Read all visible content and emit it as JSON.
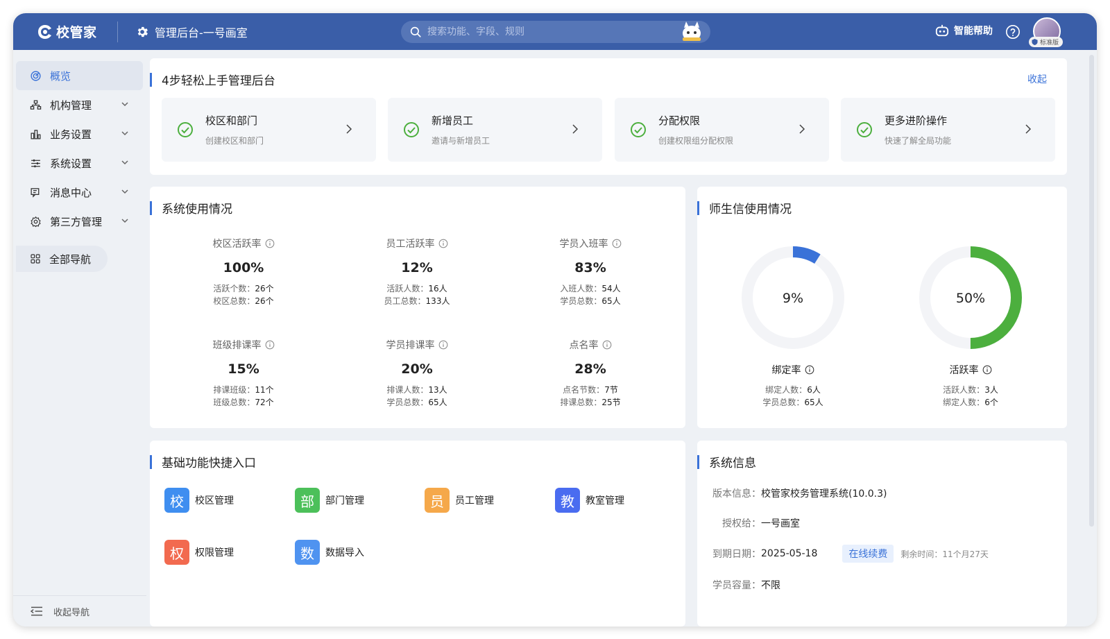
{
  "app": {
    "brand": "校管家",
    "admin_title": "管理后台-一号画室"
  },
  "search": {
    "placeholder": "搜索功能、字段、规则"
  },
  "header": {
    "help_label": "智能帮助",
    "badge_label": "标准版"
  },
  "sidebar": {
    "items": [
      {
        "label": "概览",
        "icon": "dashboard-icon",
        "active": true
      },
      {
        "label": "机构管理",
        "icon": "org-icon"
      },
      {
        "label": "业务设置",
        "icon": "bar-chart-icon"
      },
      {
        "label": "系统设置",
        "icon": "sliders-icon"
      },
      {
        "label": "消息中心",
        "icon": "message-icon"
      },
      {
        "label": "第三方管理",
        "icon": "gear-icon"
      }
    ],
    "all_nav": "全部导航",
    "collapse": "收起导航"
  },
  "guide": {
    "title": "4步轻松上手管理后台",
    "collapse": "收起",
    "steps": [
      {
        "title": "校区和部门",
        "desc": "创建校区和部门"
      },
      {
        "title": "新增员工",
        "desc": "邀请与新增员工"
      },
      {
        "title": "分配权限",
        "desc": "创建权限组分配权限"
      },
      {
        "title": "更多进阶操作",
        "desc": "快速了解全局功能"
      }
    ]
  },
  "usage": {
    "title": "系统使用情况",
    "metrics": [
      {
        "label": "校区活跃率",
        "value": "100%",
        "l1": "活跃个数：",
        "v1": "26个",
        "l2": "校区总数：",
        "v2": "26个"
      },
      {
        "label": "员工活跃率",
        "value": "12%",
        "l1": "活跃人数：",
        "v1": "16人",
        "l2": "员工总数：",
        "v2": "133人"
      },
      {
        "label": "学员入班率",
        "value": "83%",
        "l1": "入班人数：",
        "v1": "54人",
        "l2": "学员总数：",
        "v2": "65人"
      },
      {
        "label": "班级排课率",
        "value": "15%",
        "l1": "排课班级：",
        "v1": "11个",
        "l2": "班级总数：",
        "v2": "72个"
      },
      {
        "label": "学员排课率",
        "value": "20%",
        "l1": "排课人数：",
        "v1": "13人",
        "l2": "学员总数：",
        "v2": "65人"
      },
      {
        "label": "点名率",
        "value": "28%",
        "l1": "点名节数：",
        "v1": "7节",
        "l2": "排课总数：",
        "v2": "25节"
      }
    ]
  },
  "teacher_student": {
    "title": "师生信使用情况",
    "donuts": [
      {
        "value": "9%",
        "percent": 9,
        "color": "#3a72d8",
        "label": "绑定率",
        "l1": "绑定人数：",
        "v1": "6人",
        "l2": "学员总数：",
        "v2": "65人"
      },
      {
        "value": "50%",
        "percent": 50,
        "color": "#4caf3e",
        "label": "活跃率",
        "l1": "活跃人数：",
        "v1": "3人",
        "l2": "绑定人数：",
        "v2": "6个"
      }
    ]
  },
  "quick": {
    "title": "基础功能快捷入口",
    "items": [
      {
        "char": "校",
        "label": "校区管理",
        "color": "#3f8ef0"
      },
      {
        "char": "部",
        "label": "部门管理",
        "color": "#4cc05a"
      },
      {
        "char": "员",
        "label": "员工管理",
        "color": "#f5a84a"
      },
      {
        "char": "教",
        "label": "教室管理",
        "color": "#4a6cf0"
      },
      {
        "char": "权",
        "label": "权限管理",
        "color": "#f26a4f"
      },
      {
        "char": "数",
        "label": "数据导入",
        "color": "#4f93f0"
      }
    ]
  },
  "sysinfo": {
    "title": "系统信息",
    "version_key": "版本信息：",
    "version_val": "校管家校务管理系统(10.0.3)",
    "license_key": "授权给：",
    "license_val": "一号画室",
    "expire_key": "到期日期：",
    "expire_val": "2025-05-18",
    "renew": "在线续费",
    "remain": "剩余时间：11个月27天",
    "capacity_key": "学员容量：",
    "capacity_val": "不限"
  }
}
